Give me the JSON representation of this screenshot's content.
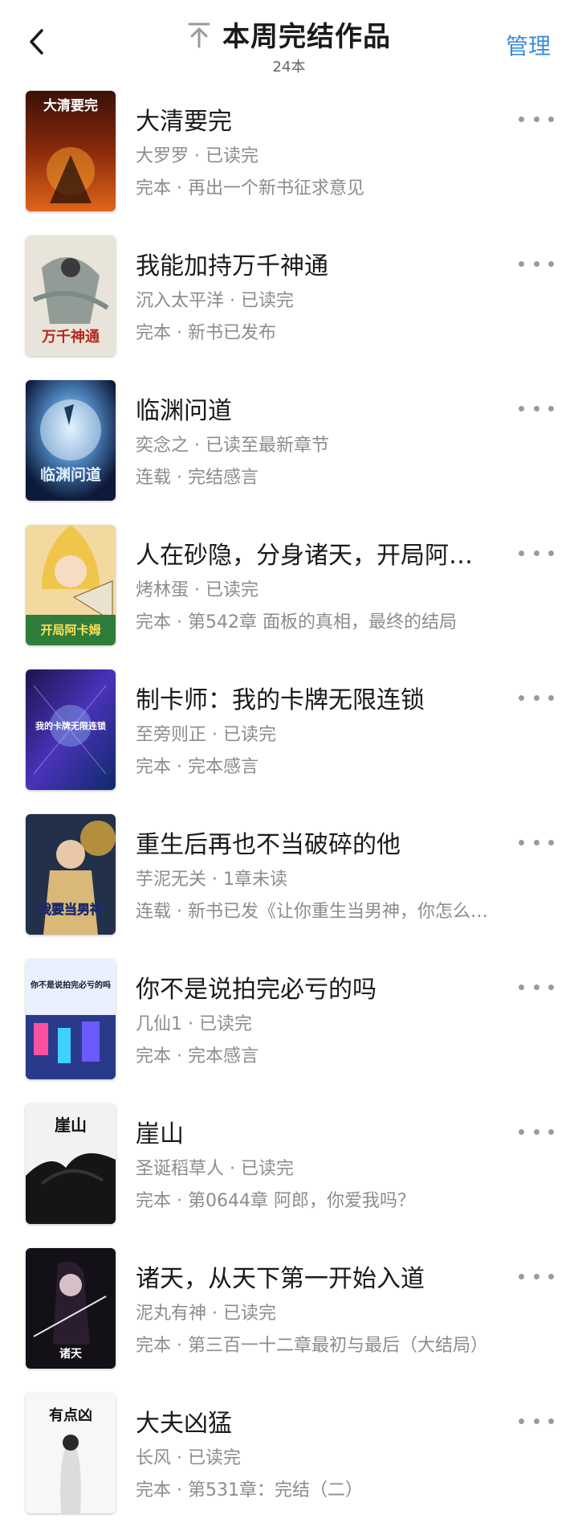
{
  "header": {
    "title": "本周完结作品",
    "count": "24本",
    "manage_label": "管理"
  },
  "colors": {
    "accent": "#3d8bd9",
    "meta_text": "#8c8c8c"
  },
  "books": [
    {
      "title": "大清要完",
      "author_line": "大罗罗 · 已读完",
      "status_line": "完本 · 再出一个新书征求意见",
      "cover_text": "大清要完",
      "cover_theme": "fire"
    },
    {
      "title": "我能加持万千神通",
      "author_line": "沉入太平洋 · 已读完",
      "status_line": "完本 · 新书已发布",
      "cover_text": "万千神通",
      "cover_theme": "ink"
    },
    {
      "title": "临渊问道",
      "author_line": "奕念之 · 已读至最新章节",
      "status_line": "连载 · 完结感言",
      "cover_text": "临渊问道",
      "cover_theme": "night"
    },
    {
      "title": "人在砂隐，分身诸天，开局阿…",
      "author_line": "烤林蛋 · 已读完",
      "status_line": "完本 · 第542章 面板的真相，最终的结局",
      "cover_text": "开局阿卡姆",
      "cover_theme": "anime"
    },
    {
      "title": "制卡师：我的卡牌无限连锁",
      "author_line": "至旁则正 · 已读完",
      "status_line": "完本 · 完本感言",
      "cover_text": "我的卡牌无限连锁",
      "cover_theme": "cosmic"
    },
    {
      "title": "重生后再也不当破碎的他",
      "author_line": "芋泥无关 · 1章未读",
      "status_line": "连载 · 新书已发《让你重生当男神，你怎么…",
      "cover_text": "我要当男神",
      "cover_theme": "gold"
    },
    {
      "title": "你不是说拍完必亏的吗",
      "author_line": "几仙1 · 已读完",
      "status_line": "完本 · 完本感言",
      "cover_text": "你不是说拍完必亏的吗",
      "cover_theme": "city"
    },
    {
      "title": "崖山",
      "author_line": "圣诞稻草人 · 已读完",
      "status_line": "完本 · 第0644章 阿郎，你爱我吗？",
      "cover_text": "崖山",
      "cover_theme": "dragon"
    },
    {
      "title": "诸天，从天下第一开始入道",
      "author_line": "泥丸有神 · 已读完",
      "status_line": "完本 · 第三百一十二章最初与最后（大结局）",
      "cover_text": "诸天",
      "cover_theme": "dark"
    },
    {
      "title": "大夫凶猛",
      "author_line": "长风 · 已读完",
      "status_line": "完本 · 第531章：完结（二）",
      "cover_text": "有点凶",
      "cover_theme": "white"
    }
  ]
}
